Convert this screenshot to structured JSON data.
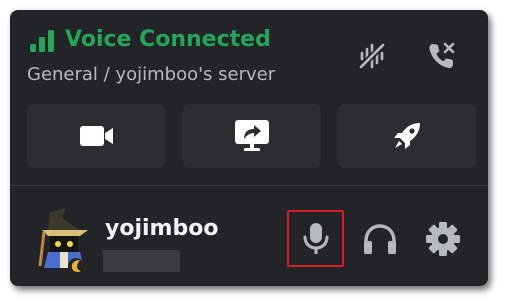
{
  "voice": {
    "status": "Voice Connected",
    "channel": "General / yojimboo's server"
  },
  "user": {
    "name": "yojimboo"
  },
  "icons": {
    "signal": "signal-bars-icon",
    "noise_suppression": "krisp-noise-suppression-icon",
    "disconnect": "phone-disconnect-icon",
    "camera": "video-camera-icon",
    "screen_share": "screen-share-icon",
    "activity": "rocket-icon",
    "microphone": "microphone-icon",
    "headphones": "headphones-icon",
    "settings": "gear-icon"
  },
  "colors": {
    "connected": "#23a55a",
    "panel_bg": "#232428",
    "button_bg": "#2b2d31",
    "highlight": "#d81f26"
  }
}
